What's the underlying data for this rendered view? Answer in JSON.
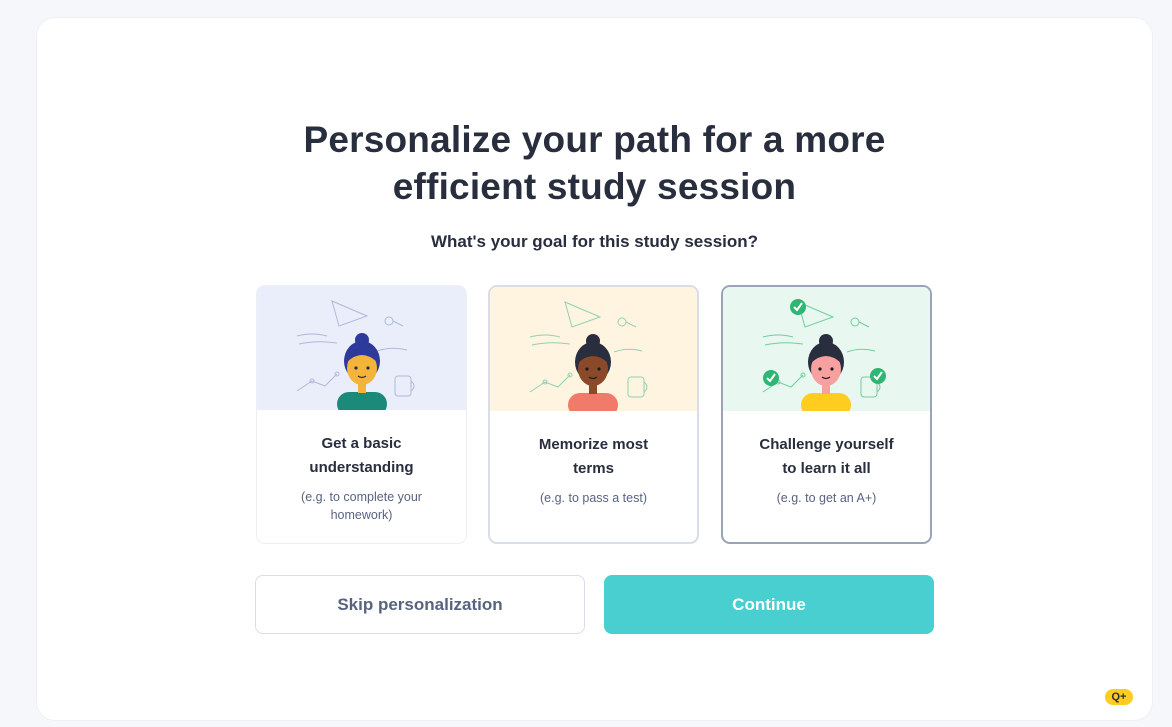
{
  "header": {
    "title_line1": "Personalize your path for a more",
    "title_line2": "efficient study session",
    "question": "What's your goal for this study session?"
  },
  "options": [
    {
      "title_line1": "Get a basic",
      "title_line2": "understanding",
      "subtitle_line1": "(e.g. to complete your",
      "subtitle_line2": "homework)",
      "bg_color": "#eaeefa",
      "shirt_color": "#1c8a7a",
      "hair_color": "#2e3a9a",
      "skin_color": "#f3b43a",
      "selected": false
    },
    {
      "title_line1": "Memorize most",
      "title_line2": "terms",
      "subtitle_line1": "(e.g. to pass a test)",
      "subtitle_line2": "",
      "bg_color": "#fff4e0",
      "shirt_color": "#f27a6a",
      "hair_color": "#282e3e",
      "skin_color": "#8a4a2a",
      "selected": false
    },
    {
      "title_line1": "Challenge yourself",
      "title_line2": "to learn it all",
      "subtitle_line1": "(e.g. to get an A+)",
      "subtitle_line2": "",
      "bg_color": "#e8f7ef",
      "shirt_color": "#ffcd1f",
      "hair_color": "#282e3e",
      "skin_color": "#f6a0a0",
      "selected": true
    }
  ],
  "buttons": {
    "skip_label": "Skip personalization",
    "continue_label": "Continue"
  },
  "badge": {
    "label": "Q+"
  },
  "colors": {
    "accent": "#4acfd0",
    "text": "#282e3e",
    "muted": "#586380",
    "badge": "#ffcd1f",
    "check": "#2fb574"
  }
}
